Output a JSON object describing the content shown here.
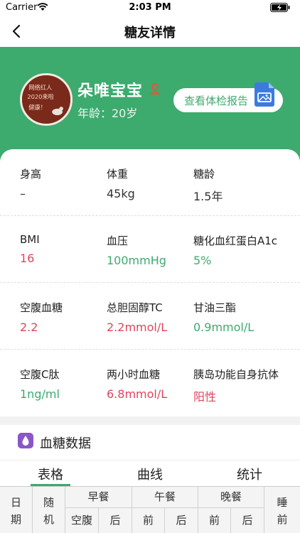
{
  "status": {
    "carrier": "Carrier",
    "time": "2:03 PM"
  },
  "nav": {
    "title": "糖友详情"
  },
  "profile": {
    "name": "朵唯宝宝",
    "age": "年龄：20岁",
    "report_button": "查看体检报告",
    "avatar_text": [
      "网络红人",
      "2020来啦",
      "健康！"
    ]
  },
  "stats": [
    [
      {
        "label": "身高",
        "value": "–"
      },
      {
        "label": "体重",
        "value": "45kg"
      },
      {
        "label": "糖龄",
        "value": "1.5年"
      }
    ],
    [
      {
        "label": "BMI",
        "value": "16"
      },
      {
        "label": "血压",
        "value": "100mmHg"
      },
      {
        "label": "糖化血红蛋白A1c",
        "value": "5%"
      }
    ],
    [
      {
        "label": "空腹血糖",
        "value": "2.2"
      },
      {
        "label": "总胆固醇TC",
        "value": "2.2mmol/L"
      },
      {
        "label": "甘油三酯",
        "value": "0.9mmol/L"
      }
    ],
    [
      {
        "label": "空腹C肽",
        "value": "1ng/ml"
      },
      {
        "label": "两小时血糖",
        "value": "6.8mmol/L"
      },
      {
        "label": "胰岛功能自身抗体",
        "value": "阳性"
      }
    ]
  ],
  "section": {
    "title": "血糖数据"
  },
  "tabs": [
    "表格",
    "曲线",
    "统计"
  ],
  "table": {
    "date": "日期",
    "random": "随机",
    "breakfast": "早餐",
    "lunch": "午餐",
    "dinner": "晚餐",
    "sleep": "睡前",
    "fasting": "空腹",
    "after": "后",
    "before": "前"
  },
  "colors": {
    "brand_green": "#3daa6e",
    "alert_red": "#e2445c",
    "purple": "#8a56c7"
  }
}
